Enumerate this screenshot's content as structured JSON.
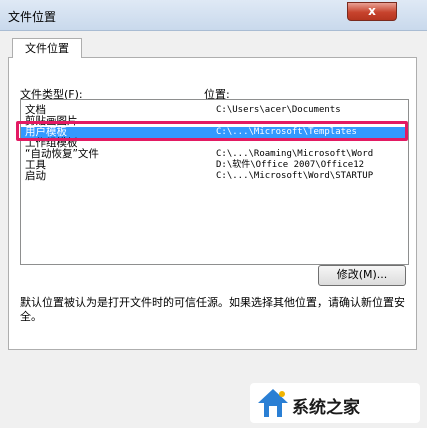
{
  "window": {
    "title": "文件位置",
    "close_label": "x"
  },
  "tab": {
    "label": "文件位置"
  },
  "columns": {
    "type": "文件类型(F):",
    "location": "位置:"
  },
  "rows": [
    {
      "type": "文档",
      "location": "C:\\Users\\acer\\Documents"
    },
    {
      "type": "剪贴画图片",
      "location": ""
    },
    {
      "type": "用户模板",
      "location": "C:\\...\\Microsoft\\Templates"
    },
    {
      "type": "工作组模板",
      "location": ""
    },
    {
      "type": "“自动恢复”文件",
      "location": "C:\\...\\Roaming\\Microsoft\\Word"
    },
    {
      "type": "工具",
      "location": "D:\\软件\\Office 2007\\Office12"
    },
    {
      "type": "启动",
      "location": "C:\\...\\Microsoft\\Word\\STARTUP"
    }
  ],
  "selected_row": 2,
  "buttons": {
    "modify": "修改(M)..."
  },
  "note": "默认位置被认为是打开文件时的可信任源。如果选择其他位置，请确认新位置安全。",
  "watermark": {
    "text": "系统之家"
  },
  "colors": {
    "selection": "#3399ff",
    "highlight": "#e31a63"
  }
}
